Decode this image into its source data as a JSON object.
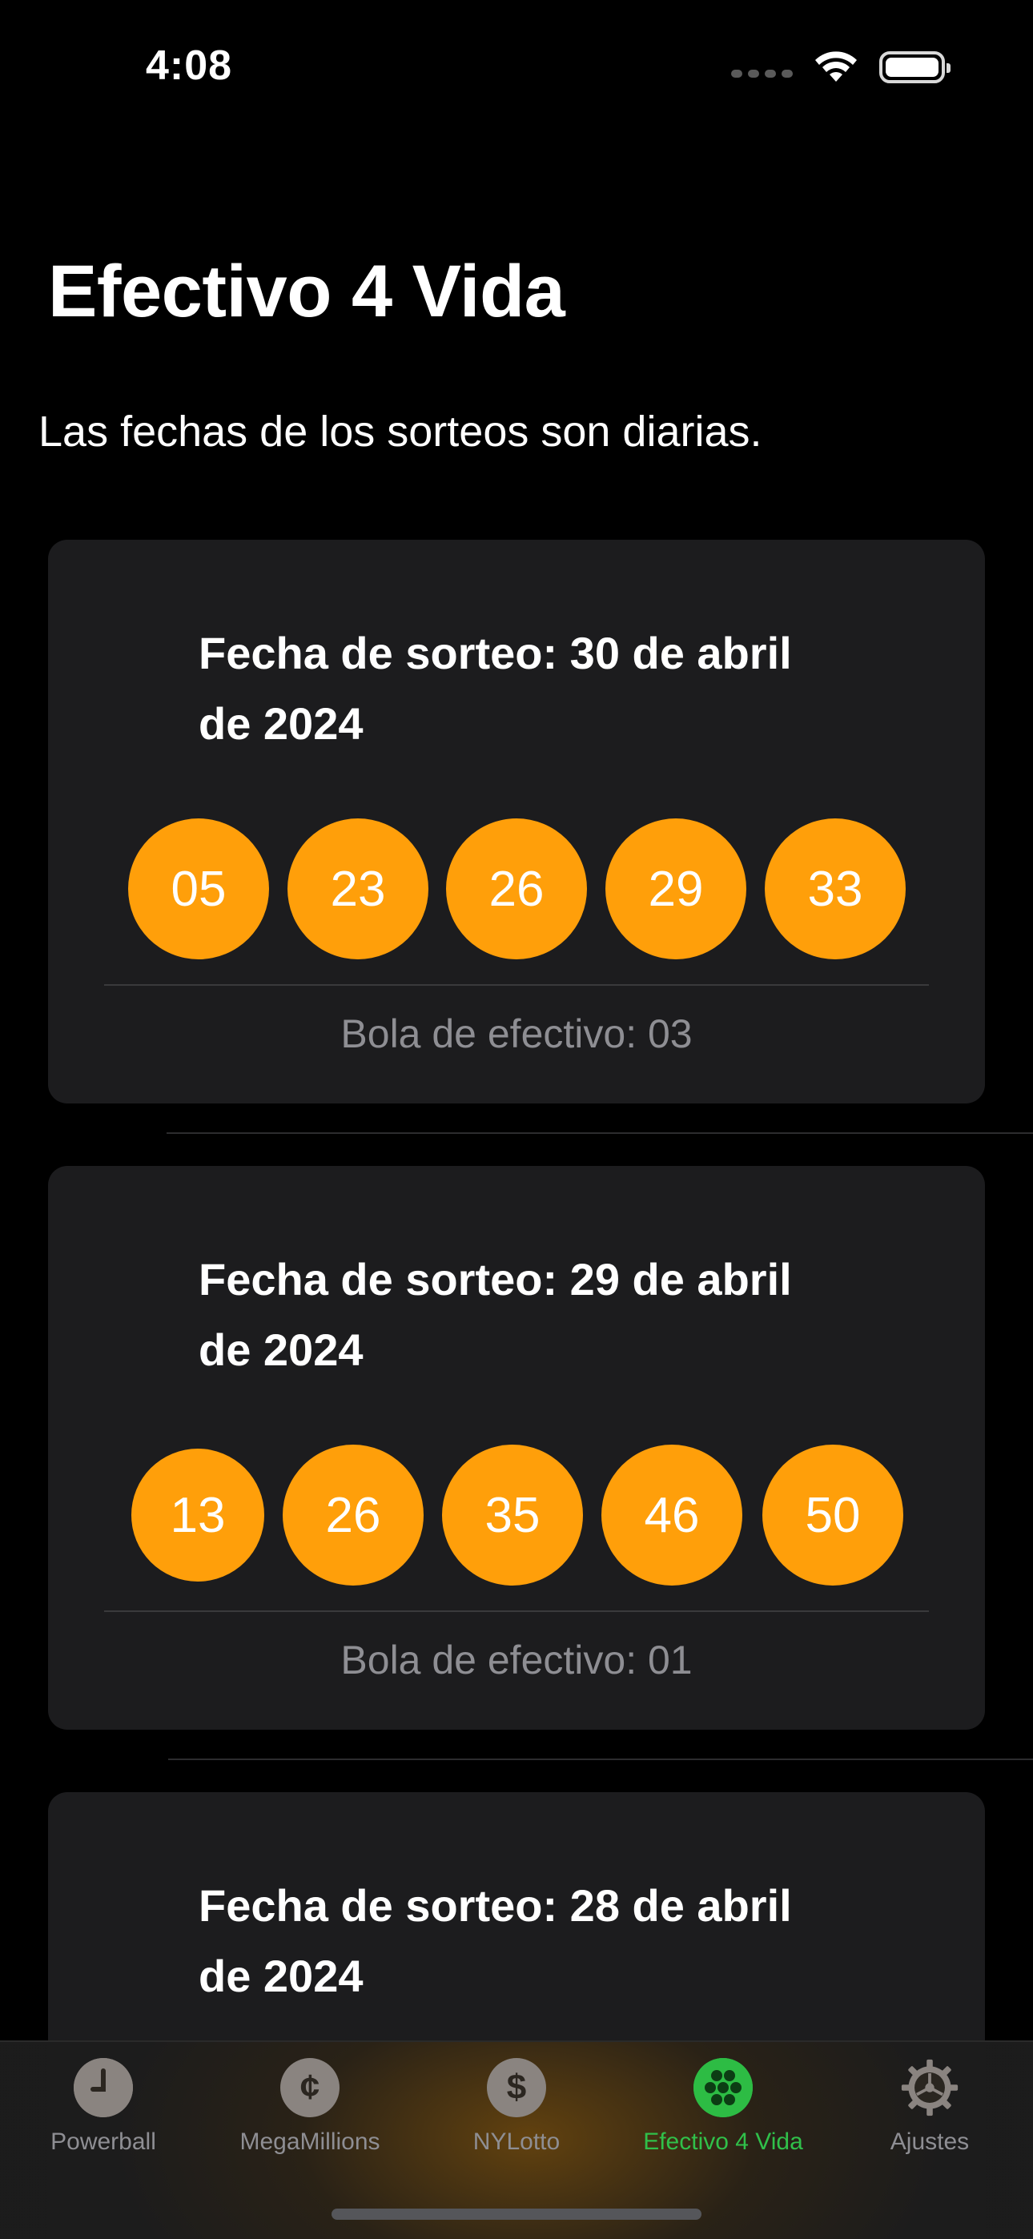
{
  "status_bar": {
    "time": "4:08"
  },
  "page": {
    "title": "Efectivo 4 Vida",
    "subtitle": "Las fechas de los sorteos son diarias."
  },
  "draws": [
    {
      "date_line1": "Fecha de sorteo: 30 de abril",
      "date_line2": "de 2024",
      "numbers": [
        "05",
        "23",
        "26",
        "29",
        "33"
      ],
      "cash_ball": "Bola de efectivo: 03"
    },
    {
      "date_line1": "Fecha de sorteo: 29 de abril",
      "date_line2": "de 2024",
      "numbers": [
        "13",
        "26",
        "35",
        "46",
        "50"
      ],
      "cash_ball": "Bola de efectivo: 01"
    },
    {
      "date_line1": "Fecha de sorteo: 28 de abril",
      "date_line2": "de 2024"
    }
  ],
  "tab_bar": {
    "tabs": [
      {
        "label": "Powerball",
        "icon": "clock-icon",
        "glyph": ""
      },
      {
        "label": "MegaMillions",
        "icon": "cent-icon",
        "glyph": "¢"
      },
      {
        "label": "NYLotto",
        "icon": "dollar-icon",
        "glyph": "$"
      },
      {
        "label": "Efectivo 4 Vida",
        "icon": "balls-icon",
        "glyph": "",
        "active": true
      },
      {
        "label": "Ajustes",
        "icon": "gear-icon",
        "glyph": ""
      }
    ]
  },
  "colors": {
    "ball": "#ff9f0a",
    "active_tab": "#30c04a",
    "card": "#1c1c1e"
  }
}
